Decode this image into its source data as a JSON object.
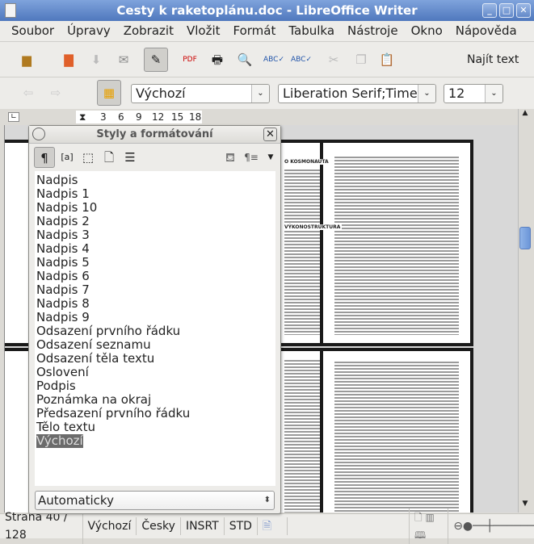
{
  "window": {
    "title": "Cesty k raketoplánu.doc - LibreOffice Writer"
  },
  "menu": [
    "Soubor",
    "Úpravy",
    "Zobrazit",
    "Vložit",
    "Formát",
    "Tabulka",
    "Nástroje",
    "Okno",
    "Nápověda"
  ],
  "toolbar": {
    "find_text": "Najít text"
  },
  "format_bar": {
    "paragraph_style": "Výchozí",
    "font_name": "Liberation Serif;Times New Roman",
    "font_size": "12"
  },
  "ruler": {
    "ticks": [
      "3",
      "6",
      "9",
      "12",
      "15",
      "18"
    ]
  },
  "styles_panel": {
    "title": "Styly a formátování",
    "items": [
      "Nadpis",
      "Nadpis 1",
      "Nadpis 10",
      "Nadpis 2",
      "Nadpis 3",
      "Nadpis 4",
      "Nadpis 5",
      "Nadpis 6",
      "Nadpis 7",
      "Nadpis 8",
      "Nadpis 9",
      "Odsazení prvního řádku",
      "Odsazení seznamu",
      "Odsazení těla textu",
      "Oslovení",
      "Podpis",
      "Poznámka na okraj",
      "Předsazení prvního řádku",
      "Tělo textu",
      "Výchozí"
    ],
    "selected": "Výchozí",
    "filter": "Automaticky"
  },
  "document": {
    "heading_left": "O KOSMONAUTA",
    "heading_left2": "VÝKONOSTRUKTURA"
  },
  "status": {
    "page": "Strana 40 / 128",
    "style": "Výchozí",
    "language": "Česky",
    "insert_mode": "INSRT",
    "selection_mode": "STD"
  }
}
